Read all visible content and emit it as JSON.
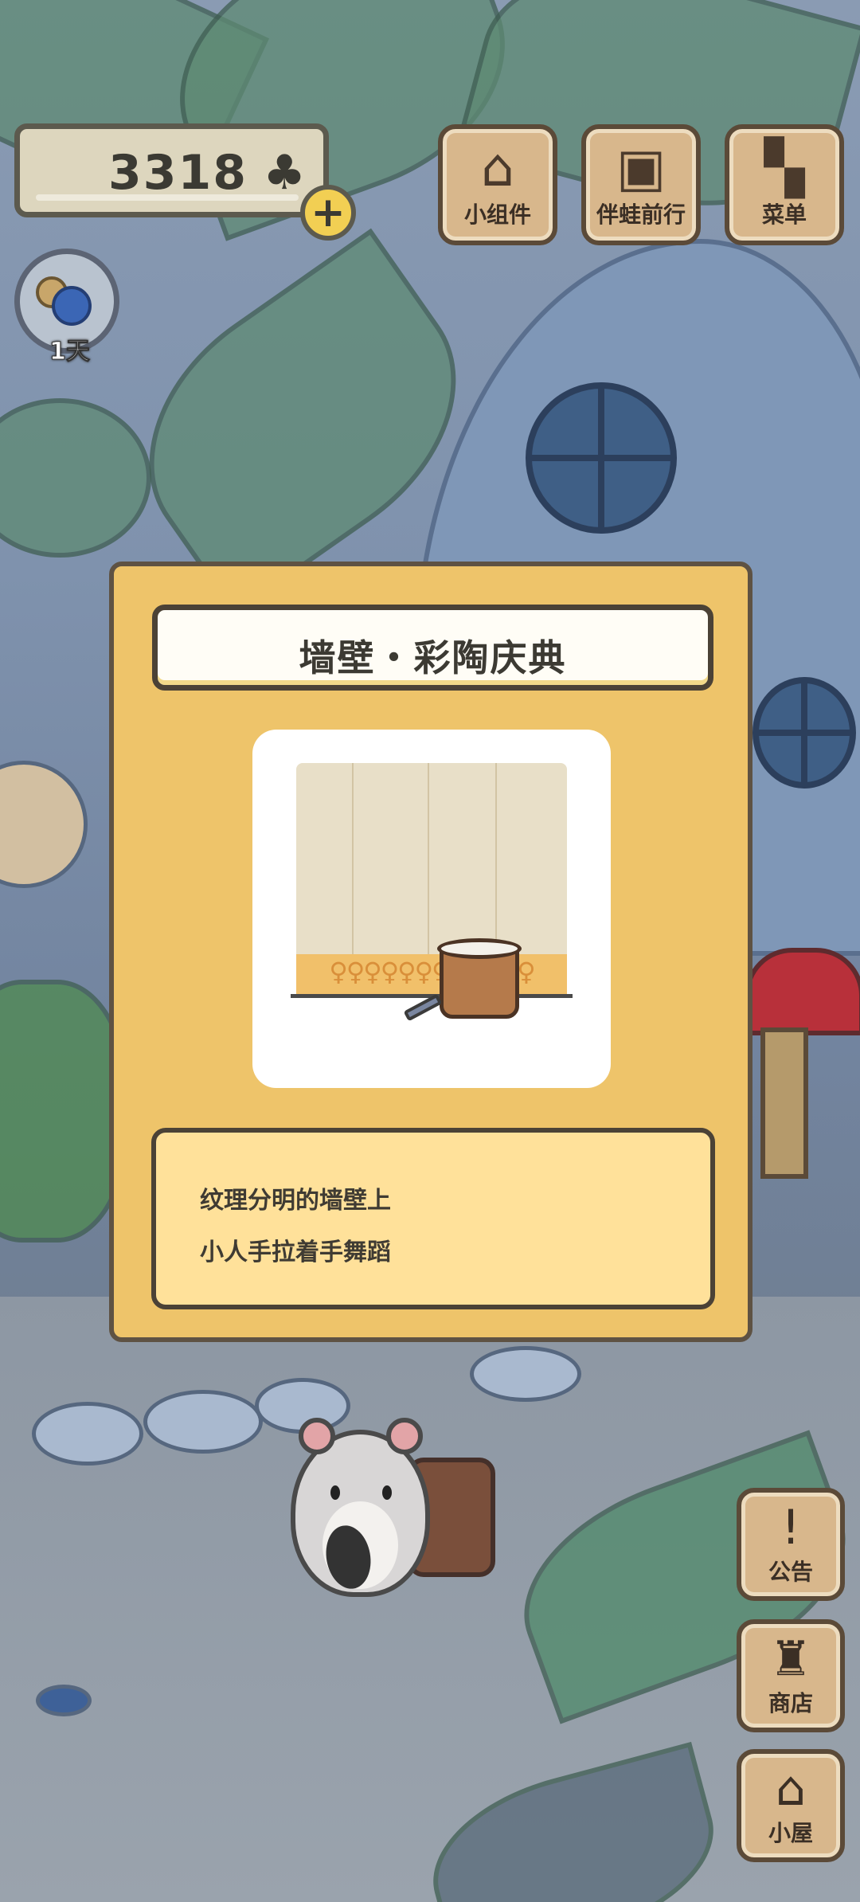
{
  "currency": {
    "value": "3318",
    "icon": "clover-icon",
    "add_icon": "plus-icon"
  },
  "status": {
    "days": "1天"
  },
  "top_menu": [
    {
      "label": "小组件",
      "icon": "widget-icon"
    },
    {
      "label": "伴蛙前行",
      "icon": "album-icon"
    },
    {
      "label": "菜单",
      "icon": "menu-icon"
    }
  ],
  "side_menu": [
    {
      "label": "公告",
      "icon": "exclamation-icon"
    },
    {
      "label": "商店",
      "icon": "shop-icon"
    },
    {
      "label": "小屋",
      "icon": "house-icon"
    }
  ],
  "dialog": {
    "title": "墙壁・彩陶庆典",
    "description": [
      "纹理分明的墙壁上",
      "小人手拉着手舞蹈"
    ]
  },
  "colors": {
    "dialog_bg": "#eec46a",
    "description_bg": "#ffe19a",
    "button_wood": "#d8b78c",
    "plus_button": "#f2cf53"
  }
}
